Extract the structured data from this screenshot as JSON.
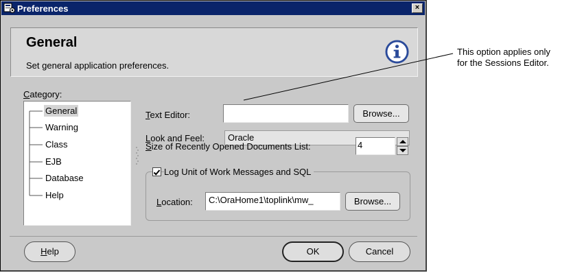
{
  "window": {
    "title": "Preferences",
    "close_label": "×"
  },
  "header": {
    "title": "General",
    "subtitle": "Set general application preferences."
  },
  "category": {
    "label_prefix": "",
    "label_mnemonic": "C",
    "label_rest": "ategory:",
    "items": [
      "General",
      "Warning",
      "Class",
      "EJB",
      "Database",
      "Help"
    ],
    "selected": "General"
  },
  "text_editor": {
    "label_mnemonic": "T",
    "label_rest": "ext Editor:",
    "value": "",
    "browse_label": "Browse..."
  },
  "look_and_feel": {
    "label_mnemonic": "L",
    "label_rest": "ook and Feel:",
    "value": "Oracle"
  },
  "recent_docs": {
    "label_mnemonic": "S",
    "label_rest": "ize of Recently Opened Documents List:",
    "value": "4"
  },
  "log_unit": {
    "label": "Log Unit of Work Messages and SQL",
    "checked": true,
    "location_label_mnemonic": "L",
    "location_label_rest": "ocation:",
    "location_value": "C:\\OraHome1\\toplink\\mw_",
    "browse_label": "Browse..."
  },
  "footer": {
    "help_mnemonic": "H",
    "help_rest": "elp",
    "ok_label": "OK",
    "cancel_label": "Cancel"
  },
  "callout": {
    "line1": "This option applies only",
    "line2": "for the Sessions Editor."
  },
  "colors": {
    "titlebar": "#0a246a",
    "dialog_bg": "#c9c9c9",
    "info_icon": "#2a4a9a"
  }
}
